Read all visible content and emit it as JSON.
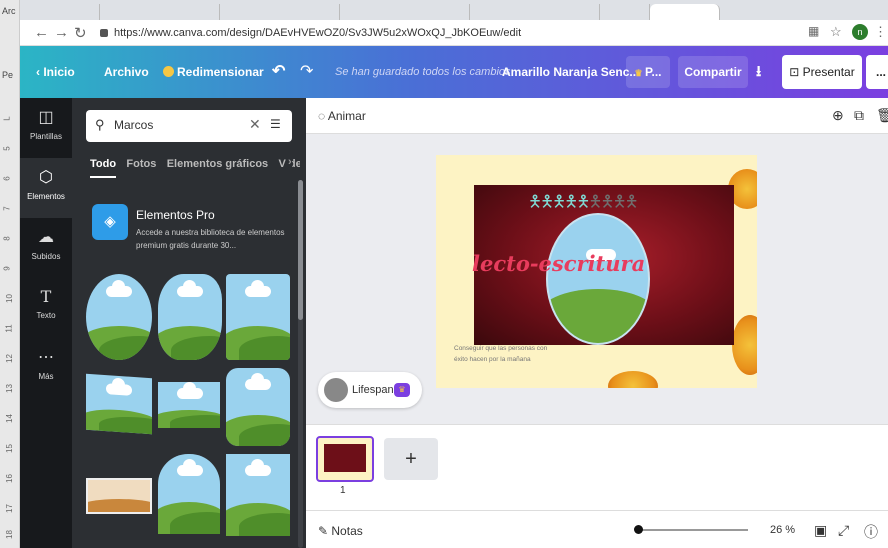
{
  "browser": {
    "url": "https://www.canva.com/design/DAEvHVEwOZ0/Sv3JW5u2xWOxQJ_JbKOEuw/edit",
    "avatar_letter": "n",
    "left_strip_labels": [
      "Arc",
      "Pe"
    ]
  },
  "topbar": {
    "home": "Inicio",
    "file": "Archivo",
    "resize": "Redimensionar",
    "saved": "Se han guardado todos los cambios",
    "doc_title": "Amarillo Naranja Senc...",
    "pro_btn": "P...",
    "share": "Compartir",
    "present": "Presentar",
    "more": "..."
  },
  "rail": [
    {
      "label": "Plantillas",
      "icon": "templates-icon"
    },
    {
      "label": "Elementos",
      "icon": "elements-icon"
    },
    {
      "label": "Subidos",
      "icon": "upload-icon"
    },
    {
      "label": "Texto",
      "icon": "text-icon"
    },
    {
      "label": "Más",
      "icon": "more-icon"
    }
  ],
  "panel": {
    "search_value": "Marcos",
    "categories": [
      "Todo",
      "Fotos",
      "Elementos gráficos",
      "Vídeos"
    ],
    "pro_title": "Elementos Pro",
    "pro_desc": "Accede a nuestra biblioteca de elementos premium gratis durante 30..."
  },
  "editor": {
    "animate": "Animar",
    "canvas_title": "lecto-escritura",
    "canvas_small": "Conseguir que las personas con éxito hacen por la mañana",
    "lifespan": "Lifespan",
    "page_number": "1",
    "add_page": "+",
    "notes": "Notas",
    "zoom": "26 %",
    "zoom_fraction": 0.26
  },
  "ruler_ticks": [
    "L",
    "5",
    "6",
    "7",
    "8",
    "9",
    "10",
    "11",
    "12",
    "13",
    "14",
    "15",
    "16",
    "17",
    "18"
  ],
  "colors": {
    "accent": "#7b3fe0",
    "gradient_start": "#2bb5c5",
    "rail": "#17191c",
    "panel": "#2c2f33"
  }
}
